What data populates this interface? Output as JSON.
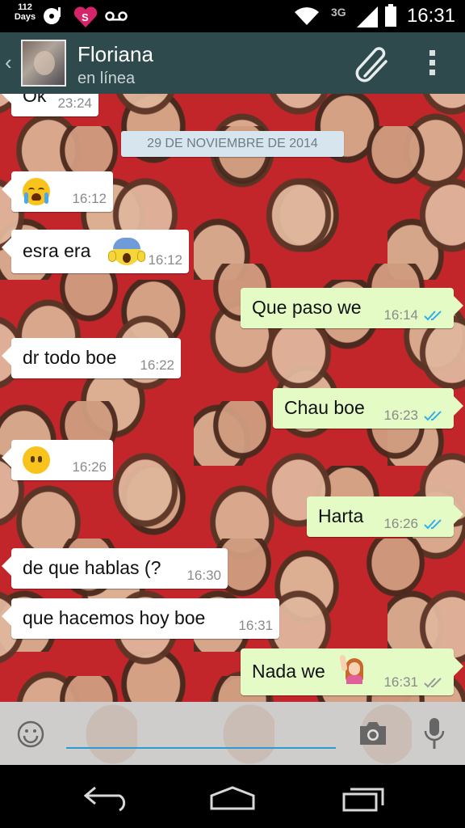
{
  "status_bar": {
    "days_number": "112",
    "days_label": "Days",
    "network": "3G",
    "time": "16:31"
  },
  "header": {
    "contact_name": "Floriana",
    "contact_status": "en línea"
  },
  "chat": {
    "date_separator": "29 DE NOVIEMBRE DE 2014",
    "messages": [
      {
        "direction": "in",
        "text": "Ok",
        "time": "23:24"
      },
      {
        "direction": "in",
        "text": "",
        "emoji": "crying-face",
        "time": "16:12"
      },
      {
        "direction": "in",
        "text": "esra era",
        "emoji": "screaming-face",
        "time": "16:12"
      },
      {
        "direction": "out",
        "text": "Que paso we",
        "time": "16:14",
        "status": "read"
      },
      {
        "direction": "in",
        "text": "dr todo boe",
        "time": "16:22"
      },
      {
        "direction": "out",
        "text": "Chau boe",
        "time": "16:23",
        "status": "read"
      },
      {
        "direction": "in",
        "text": "",
        "emoji": "face-without-mouth",
        "time": "16:26"
      },
      {
        "direction": "out",
        "text": "Harta",
        "time": "16:26",
        "status": "read"
      },
      {
        "direction": "in",
        "text": "de que hablas (?",
        "time": "16:30"
      },
      {
        "direction": "in",
        "text": "que hacemos hoy boe",
        "time": "16:31"
      },
      {
        "direction": "out",
        "text": "Nada we",
        "emoji": "woman-raising-hand",
        "time": "16:31",
        "status": "delivered"
      }
    ]
  },
  "input": {
    "placeholder": "",
    "value": ""
  },
  "colors": {
    "header_bg": "#2f4a4c",
    "outgoing_bubble": "#e4fbc6",
    "incoming_bubble": "#ffffff",
    "read_ticks": "#34b0e6",
    "delivered_ticks": "#9a9a9a",
    "input_underline": "#2b9bd6"
  }
}
